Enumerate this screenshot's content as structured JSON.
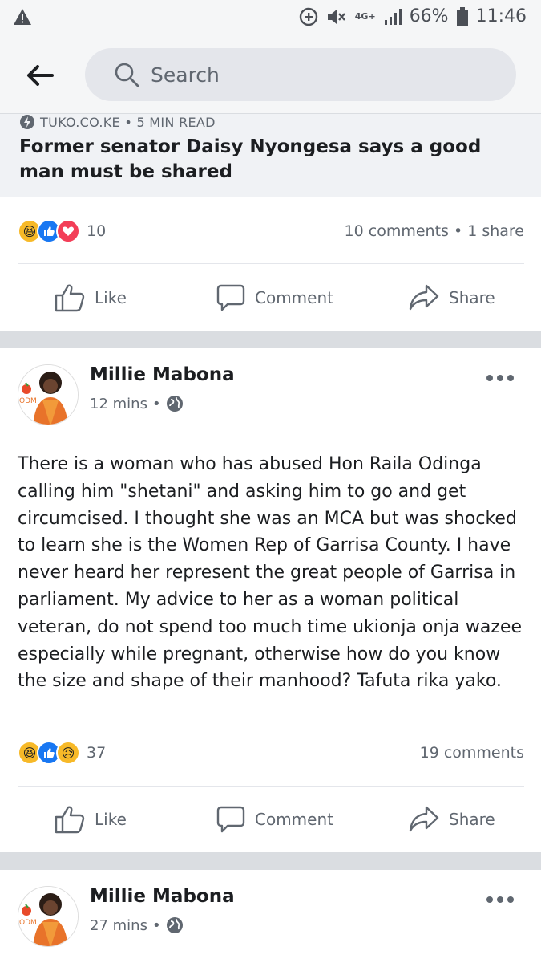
{
  "status_bar": {
    "battery": "66%",
    "time": "11:46",
    "network": "4G+"
  },
  "header": {
    "search_placeholder": "Search"
  },
  "link_preview": {
    "source": "TUKO.CO.KE • 5 MIN READ",
    "title": "Former senator Daisy Nyongesa says a good man must be shared"
  },
  "shared_post": {
    "reaction_count": "10",
    "counts": "10 comments • 1 share"
  },
  "actions": {
    "like": "Like",
    "comment": "Comment",
    "share": "Share"
  },
  "post1": {
    "author": "Millie Mabona",
    "time": "12 mins",
    "text": "There is a woman who has abused Hon Raila Odinga calling him \"shetani\" and asking him to go and get circumcised. I thought she was an MCA but was shocked to learn she is the Women Rep of Garrisa County. I have never heard her represent the great people of Garrisa in parliament. My advice to her as a woman political veteran, do not spend too much time ukionja onja wazee especially while pregnant, otherwise how do you know the size and shape of their manhood? Tafuta rika yako.",
    "reaction_count": "37",
    "counts": "19 comments"
  },
  "post2": {
    "author": "Millie Mabona",
    "time": "27 mins"
  },
  "avatar_badge": "ODM",
  "colors": {
    "like_blue": "#1877f2",
    "love_red": "#f33e58",
    "haha_yellow": "#f7b928",
    "muted_text": "#606770",
    "separator": "#dadde1"
  }
}
